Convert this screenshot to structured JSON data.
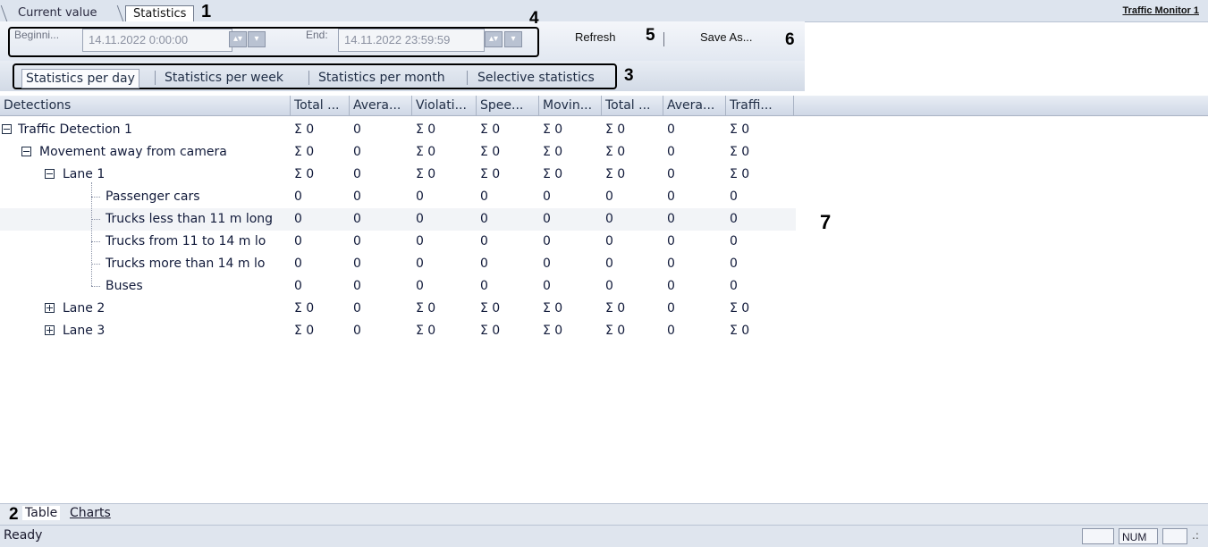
{
  "window": {
    "title": "Traffic Monitor 1"
  },
  "top_tabs": [
    {
      "label": "Current value"
    },
    {
      "label": "Statistics"
    }
  ],
  "toolbar": {
    "begin_label": "Beginni...",
    "begin_value": "14.11.2022 0:00:00",
    "end_label": "End:",
    "end_value": "14.11.2022 23:59:59",
    "refresh_label": "Refresh",
    "save_as_label": "Save As...",
    "spin_icon": "updown-spin-icon",
    "dropdown_icon": "chevron-down-icon"
  },
  "period_tabs": [
    {
      "label": "Statistics per day",
      "active": true
    },
    {
      "label": "Statistics per week"
    },
    {
      "label": "Statistics per month"
    },
    {
      "label": "Selective statistics"
    }
  ],
  "table": {
    "columns": [
      "Detections",
      "Total ...",
      "Avera...",
      "Violati...",
      "Spee...",
      "Movin...",
      "Total ...",
      "Avera...",
      "Traffi..."
    ],
    "rows": [
      {
        "label": "Traffic Detection 1",
        "level": 0,
        "expander": "minus",
        "values": [
          "Σ 0",
          "0",
          "Σ 0",
          "Σ 0",
          "Σ 0",
          "Σ 0",
          "0",
          "Σ 0"
        ]
      },
      {
        "label": "Movement away from camera",
        "level": 1,
        "expander": "minus",
        "values": [
          "Σ 0",
          "0",
          "Σ 0",
          "Σ 0",
          "Σ 0",
          "Σ 0",
          "0",
          "Σ 0"
        ]
      },
      {
        "label": "Lane 1",
        "level": 2,
        "expander": "minus",
        "values": [
          "Σ 0",
          "0",
          "Σ 0",
          "Σ 0",
          "Σ 0",
          "Σ 0",
          "0",
          "Σ 0"
        ]
      },
      {
        "label": "Passenger cars",
        "level": 3,
        "expander": "",
        "values": [
          "0",
          "0",
          "0",
          "0",
          "0",
          "0",
          "0",
          "0"
        ]
      },
      {
        "label": "Trucks less than 11 m long",
        "level": 3,
        "expander": "",
        "selected": true,
        "values": [
          "0",
          "0",
          "0",
          "0",
          "0",
          "0",
          "0",
          "0"
        ]
      },
      {
        "label": "Trucks from 11 to 14 m lo",
        "level": 3,
        "expander": "",
        "values": [
          "0",
          "0",
          "0",
          "0",
          "0",
          "0",
          "0",
          "0"
        ]
      },
      {
        "label": "Trucks more than 14 m lo",
        "level": 3,
        "expander": "",
        "values": [
          "0",
          "0",
          "0",
          "0",
          "0",
          "0",
          "0",
          "0"
        ]
      },
      {
        "label": "Buses",
        "level": 3,
        "expander": "",
        "values": [
          "0",
          "0",
          "0",
          "0",
          "0",
          "0",
          "0",
          "0"
        ]
      },
      {
        "label": "Lane 2",
        "level": 2,
        "expander": "plus",
        "values": [
          "Σ 0",
          "0",
          "Σ 0",
          "Σ 0",
          "Σ 0",
          "Σ 0",
          "0",
          "Σ 0"
        ]
      },
      {
        "label": "Lane 3",
        "level": 2,
        "expander": "plus",
        "values": [
          "Σ 0",
          "0",
          "Σ 0",
          "Σ 0",
          "Σ 0",
          "Σ 0",
          "0",
          "Σ 0"
        ]
      }
    ]
  },
  "bottom_tabs": [
    {
      "label": "Table",
      "active": true
    },
    {
      "label": "Charts"
    }
  ],
  "status": {
    "text": "Ready",
    "num": "NUM",
    "grip": ".:"
  },
  "callouts": {
    "c1": "1",
    "c2": "2",
    "c3": "3",
    "c4": "4",
    "c5": "5",
    "c6": "6",
    "c7": "7"
  },
  "colors": {
    "header_bg": "#cfd8e6",
    "toolbar_bg": "#e2e8f1",
    "accent": "#1f2d45"
  }
}
